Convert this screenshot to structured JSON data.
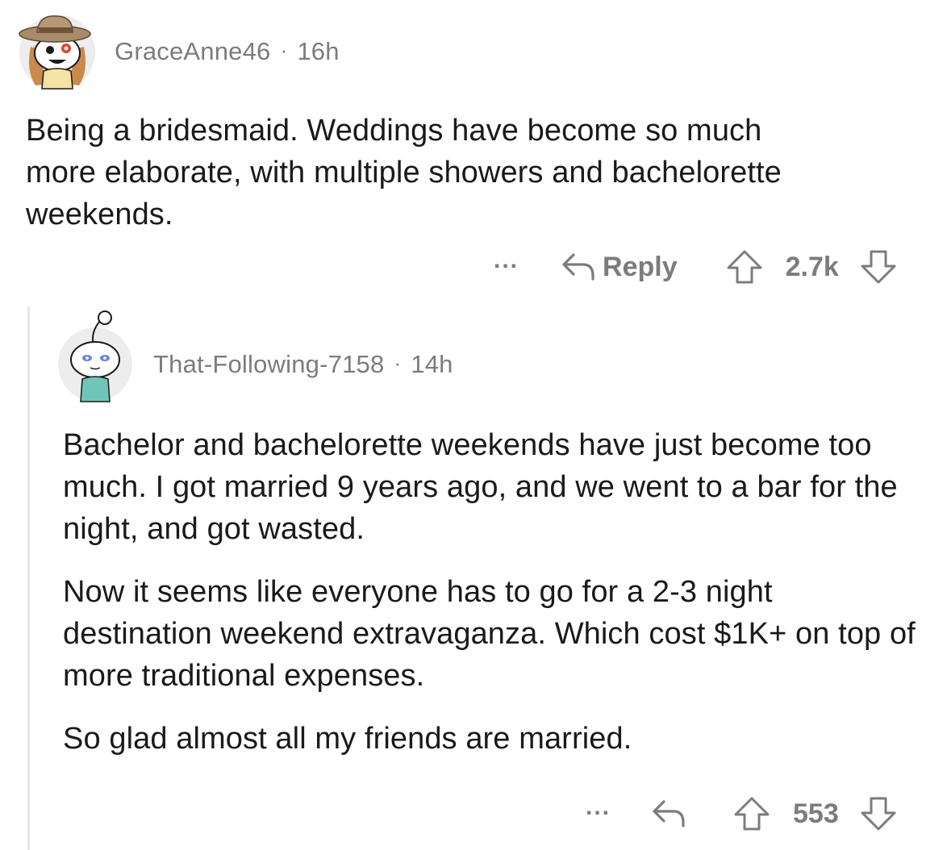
{
  "comment": {
    "username": "GraceAnne46",
    "separator": "·",
    "age": "16h",
    "avatar_icon": "snoo-avatar-hat-icon",
    "text_lines": [
      "Being a bridesmaid. Weddings have become so much",
      "more elaborate, with multiple showers and bachelorette",
      "weekends."
    ],
    "more_label": "...",
    "reply_label": "Reply",
    "score": "2.7k"
  },
  "reply": {
    "username": "That-Following-7158",
    "separator": "·",
    "age": "14h",
    "avatar_icon": "snoo-avatar-icon",
    "paragraphs": [
      "Bachelor and bachelorette weekends have just become too much. I got married 9 years ago, and we went to a bar for the night, and got wasted.",
      "Now it seems like everyone has to go for a 2-3 night destination weekend extravaganza. Which cost $1K+ on top of more traditional expenses.",
      "So glad almost all my friends are married."
    ],
    "more_label": "...",
    "score": "553"
  },
  "colors": {
    "text": "#1a1a1a",
    "meta": "#7c7c7c",
    "thread_line": "#e6e6e6"
  }
}
